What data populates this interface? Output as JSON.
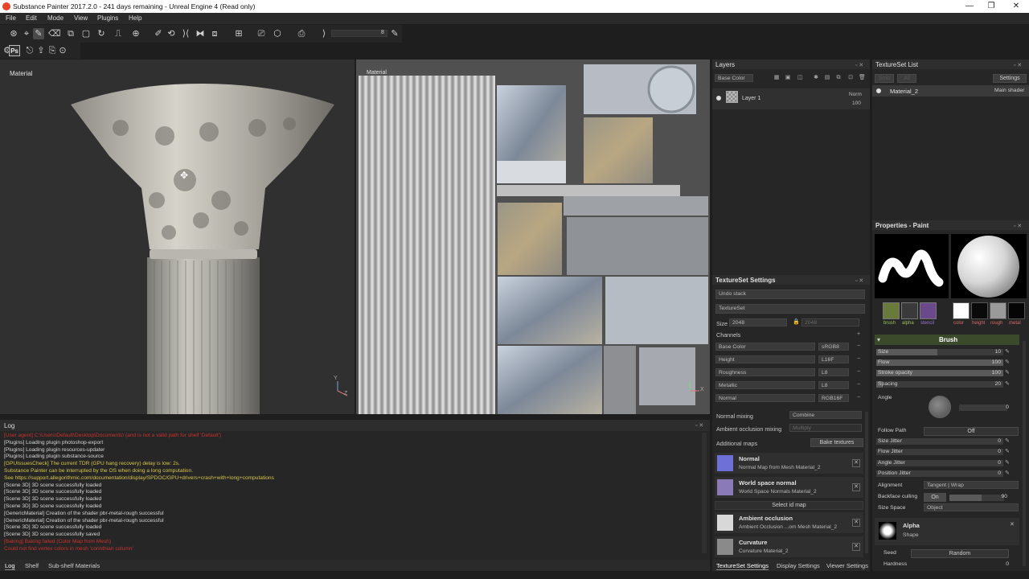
{
  "window": {
    "title": "Substance Painter 2017.2.0 - 241 days remaining - Unreal Engine 4 (Read only)",
    "controls": [
      "—",
      "❐",
      "✕"
    ]
  },
  "menu": [
    "File",
    "Edit",
    "Mode",
    "View",
    "Plugins",
    "Help"
  ],
  "toolbar": {
    "zoom_value": "8"
  },
  "viewport3d": {
    "label": "Material",
    "axis_y": "Y",
    "axis_z": "Z"
  },
  "viewport2d": {
    "label": "Material",
    "axis_y": "Y",
    "axis_x": "X"
  },
  "log": {
    "title": "Log",
    "lines": [
      {
        "text": "[User agent] C:\\Users\\Default\\Desktop\\Documents\\ (and is not a valid path for shelf 'Default')",
        "level": "error"
      },
      {
        "text": "[Plugins] Loading plugin photoshop-export",
        "level": "info"
      },
      {
        "text": "[Plugins] Loading plugin resources-updater",
        "level": "info"
      },
      {
        "text": "[Plugins] Loading plugin substance-source",
        "level": "info"
      },
      {
        "text": "[GPUIssuesCheck] The current TDR (GPU hang recovery) delay is low: 2s.",
        "level": "warn"
      },
      {
        "text": "   Substance Painter can be interrupted by the OS when doing a long computation.",
        "level": "warn"
      },
      {
        "text": "   See https://support.allegorithmic.com/documentation/display/SPDOC/GPU+drivers+crash+with+long+computations",
        "level": "warn"
      },
      {
        "text": "[Scene 3D] 3D scene successfully loaded",
        "level": "info"
      },
      {
        "text": "[Scene 3D] 3D scene successfully loaded",
        "level": "info"
      },
      {
        "text": "[Scene 3D] 3D scene successfully loaded",
        "level": "info"
      },
      {
        "text": "[Scene 3D] 3D scene successfully loaded",
        "level": "info"
      },
      {
        "text": "[GenericMaterial] Creation of the shader pbr-metal-rough successful",
        "level": "info"
      },
      {
        "text": "[GenericMaterial] Creation of the shader pbr-metal-rough successful",
        "level": "info"
      },
      {
        "text": "[Scene 3D] 3D scene successfully loaded",
        "level": "info"
      },
      {
        "text": "[Scene 3D] 3D scene successfully saved",
        "level": "info"
      },
      {
        "text": "[Baking] Baking failed (Color Map from Mesh)",
        "level": "error"
      },
      {
        "text": "Could not find vertex colors in mesh 'corinthian column'",
        "level": "error"
      }
    ],
    "colors": {
      "info": "#d6d6d6",
      "warn": "#d8c64a",
      "error": "#c8322c"
    }
  },
  "bottom_tabs": [
    "Log",
    "Shelf",
    "Sub-shelf Materials"
  ],
  "layers": {
    "title": "Layers",
    "channel_select": "Base Color",
    "layer_name": "Layer 1",
    "blend": "Norm",
    "opacity": "100"
  },
  "textureset_list": {
    "title": "TextureSet List",
    "btn_solo": "Solo",
    "btn_all": "All",
    "settings_btn": "Settings",
    "item_name": "Material_2",
    "item_shader": "Main shader"
  },
  "textureset_settings": {
    "title": "TextureSet Settings",
    "undo_stack": "Undo stack",
    "textureset": "TextureSet",
    "size_label": "Size",
    "size_value": "2048",
    "size_value2": "2048",
    "channels_label": "Channels",
    "channels": [
      {
        "name": "Base Color",
        "format": "sRGB8"
      },
      {
        "name": "Height",
        "format": "L16F"
      },
      {
        "name": "Roughness",
        "format": "L8"
      },
      {
        "name": "Metallic",
        "format": "L8"
      },
      {
        "name": "Normal",
        "format": "RGB16F"
      }
    ],
    "normal_mixing_label": "Normal mixing",
    "normal_mixing_value": "Combine",
    "ao_mixing_label": "Ambient occlusion mixing",
    "ao_mixing_value": "Multiply",
    "additional_maps_label": "Additional maps",
    "bake_button": "Bake textures",
    "maps": [
      {
        "title": "Normal",
        "sub": "Normal Map from Mesh Material_2",
        "color": "#6f6fd8"
      },
      {
        "title": "World space normal",
        "sub": "World Space Normals Material_2",
        "color": "#8a7ab8"
      },
      {
        "title": "Ambient occlusion",
        "sub": "Ambient Occlusion ...om Mesh Material_2",
        "color": "#d8d8d8"
      },
      {
        "title": "Curvature",
        "sub": "Curvature Material_2",
        "color": "#8a8a8a"
      }
    ],
    "select_id_btn": "Select id map"
  },
  "right_bottom_tabs": [
    "TextureSet Settings",
    "Display Settings",
    "Viewer Settings"
  ],
  "properties": {
    "title": "Properties - Paint",
    "slots": [
      {
        "label": "brush",
        "color": "#6a7a3a"
      },
      {
        "label": "alpha",
        "color": "#3a3a3a"
      },
      {
        "label": "stencil",
        "color": "#6a4a8a"
      }
    ],
    "mats": [
      {
        "label": "color",
        "color": "#ffffff"
      },
      {
        "label": "height",
        "color": "#0a0a0a"
      },
      {
        "label": "rough",
        "color": "#9a9a9a"
      },
      {
        "label": "metal",
        "color": "#050505"
      }
    ],
    "brush_section": "Brush",
    "size_label": "Size",
    "size_value": "10",
    "size_fill": 0.48,
    "flow_label": "Flow",
    "flow_value": "100",
    "flow_fill": 1.0,
    "stroke_label": "Stroke opacity",
    "stroke_value": "100",
    "stroke_fill": 1.0,
    "spacing_label": "Spacing",
    "spacing_value": "20",
    "spacing_fill": 0.05,
    "angle_label": "Angle",
    "angle_value": "0",
    "follow_path_label": "Follow Path",
    "follow_path_value": "Off",
    "size_jitter_label": "Size Jitter",
    "size_jitter_value": "0",
    "flow_jitter_label": "Flow Jitter",
    "flow_jitter_value": "0",
    "angle_jitter_label": "Angle Jitter",
    "angle_jitter_value": "0",
    "position_jitter_label": "Position Jitter",
    "position_jitter_value": "0",
    "alignment_label": "Alignment",
    "alignment_value": "Tangent | Wrap",
    "backface_label": "Backface culling",
    "backface_toggle": "On",
    "backface_value": "90",
    "size_space_label": "Size Space",
    "size_space_value": "Object",
    "alpha_title": "Alpha",
    "alpha_sub": "Shape",
    "seed_label": "Seed",
    "seed_value": "Random",
    "hardness_label": "Hardness",
    "hardness_value": "0"
  }
}
